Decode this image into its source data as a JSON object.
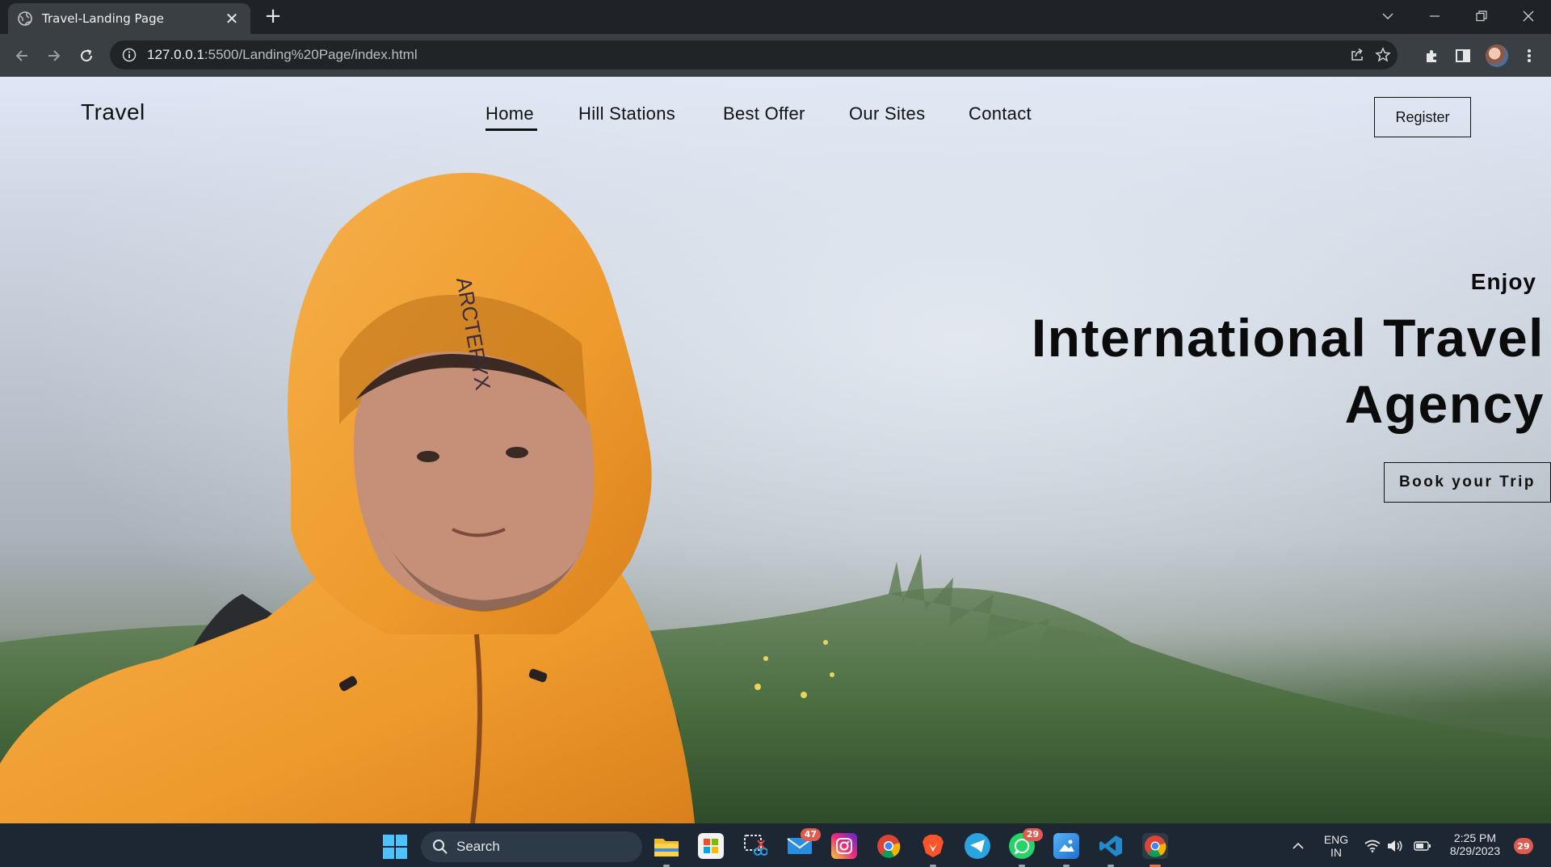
{
  "browser": {
    "tab_title": "Travel-Landing Page",
    "tab_close": "✕",
    "new_tab": "+",
    "url_host": "127.0.0.1",
    "url_path": ":5500/Landing%20Page/index.html"
  },
  "site": {
    "brand": "Travel",
    "menu": [
      {
        "label": "Home",
        "active": true
      },
      {
        "label": "Hill Stations",
        "active": false
      },
      {
        "label": "Best Offer",
        "active": false
      },
      {
        "label": "Our Sites",
        "active": false
      },
      {
        "label": "Contact",
        "active": false
      }
    ],
    "register_label": "Register",
    "hero": {
      "kicker": "Enjoy",
      "title": "International Travel Agency",
      "cta_label": "Book your Trip"
    },
    "hero_image_text": "ARCTERYX"
  },
  "taskbar": {
    "search_label": "Search",
    "apps": [
      {
        "name": "file-explorer",
        "badge": ""
      },
      {
        "name": "microsoft-store",
        "badge": ""
      },
      {
        "name": "snipping-tool",
        "badge": ""
      },
      {
        "name": "mail",
        "badge": "47"
      },
      {
        "name": "instagram",
        "badge": ""
      },
      {
        "name": "chrome",
        "badge": ""
      },
      {
        "name": "brave",
        "badge": ""
      },
      {
        "name": "telegram",
        "badge": ""
      },
      {
        "name": "whatsapp",
        "badge": "29"
      },
      {
        "name": "photos",
        "badge": ""
      },
      {
        "name": "vscode",
        "badge": ""
      },
      {
        "name": "chrome-active",
        "badge": ""
      }
    ],
    "lang_line1": "ENG",
    "lang_line2": "IN",
    "time": "2:25 PM",
    "date": "8/29/2023",
    "notification_count": "29"
  },
  "colors": {
    "browser_frame": "#1f2328",
    "toolbar": "#3a3f44",
    "taskbar": "#1c2733",
    "jacket_orange": "#f0a033",
    "accent_badge": "#e05a4e"
  }
}
